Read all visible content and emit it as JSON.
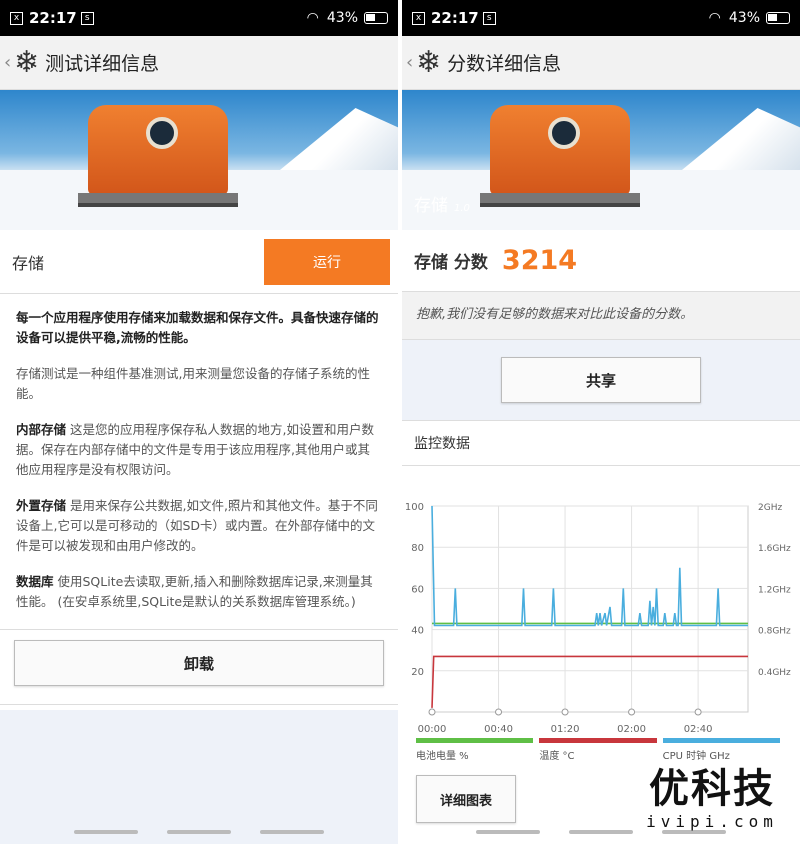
{
  "status_bar": {
    "time": "22:17",
    "battery": "43%"
  },
  "left": {
    "title": "测试详细信息",
    "test_label": "存储",
    "run_label": "运行",
    "intro": "每一个应用程序使用存储来加载数据和保存文件。具备快速存储的设备可以提供平稳,流畅的性能。",
    "para1": "存储测试是一种组件基准测试,用来测量您设备的存储子系统的性能。",
    "internal_term": "内部存储",
    "internal_text": " 这是您的应用程序保存私人数据的地方,如设置和用户数据。保存在内部存储中的文件是专用于该应用程序,其他用户或其他应用程序是没有权限访问。",
    "external_term": "外置存储",
    "external_text": " 是用来保存公共数据,如文件,照片和其他文件。基于不同设备上,它可以是可移动的（如SD卡）或内置。在外部存储中的文件是可以被发现和由用户修改的。",
    "db_term": "数据库",
    "db_text": " 使用SQLite去读取,更新,插入和删除数据库记录,来测量其性能。 (在安卓系统里,SQLite是默认的关系数据库管理系统。)",
    "uninstall_label": "卸载"
  },
  "right": {
    "title": "分数详细信息",
    "hero_label": "存储",
    "hero_version": "1.0",
    "score_label": "存储 分数",
    "score_value": "3214",
    "sorry_text": "抱歉,我们没有足够的数据来对比此设备的分数。",
    "share_label": "共享",
    "monitor_title": "监控数据",
    "detail_label": "详细图表",
    "legend": [
      {
        "label": "电池电量 %",
        "color": "#5fbf46"
      },
      {
        "label": "温度 °C",
        "color": "#c8363c"
      },
      {
        "label": "CPU 时钟 GHz",
        "color": "#4aaede"
      }
    ]
  },
  "watermark": {
    "line1": "优科技",
    "line2": "ivipi.com"
  },
  "chart_data": {
    "type": "line",
    "x_ticks": [
      "00:00",
      "00:40",
      "01:20",
      "02:00",
      "02:40"
    ],
    "x_range_sec": [
      0,
      190
    ],
    "y_left_ticks": [
      20,
      40,
      60,
      80,
      100
    ],
    "y_left_range": [
      0,
      100
    ],
    "y_right_ticks": [
      "0.4GHz",
      "0.8GHz",
      "1.2GHz",
      "1.6GHz",
      "2GHz"
    ],
    "y_right_range_ghz": [
      0,
      2.0
    ],
    "grid": true,
    "series": [
      {
        "name": "电池电量 %",
        "axis": "left",
        "color": "#5fbf46",
        "points": [
          [
            0,
            43
          ],
          [
            1,
            43
          ],
          [
            190,
            43
          ]
        ]
      },
      {
        "name": "温度 °C",
        "axis": "left",
        "color": "#c8363c",
        "points": [
          [
            0,
            2
          ],
          [
            1,
            27
          ],
          [
            190,
            27
          ]
        ]
      },
      {
        "name": "CPU 时钟 GHz",
        "axis": "right",
        "color": "#4aaede",
        "points": [
          [
            0,
            2.0
          ],
          [
            1.5,
            0.84
          ],
          [
            13,
            0.84
          ],
          [
            14,
            1.2
          ],
          [
            15,
            0.84
          ],
          [
            54,
            0.84
          ],
          [
            55,
            1.2
          ],
          [
            56,
            0.84
          ],
          [
            72,
            0.84
          ],
          [
            73,
            1.2
          ],
          [
            74,
            0.84
          ],
          [
            98,
            0.84
          ],
          [
            99,
            0.96
          ],
          [
            100,
            0.84
          ],
          [
            101,
            0.96
          ],
          [
            102,
            0.84
          ],
          [
            104,
            0.96
          ],
          [
            105,
            0.84
          ],
          [
            107,
            1.02
          ],
          [
            108,
            0.84
          ],
          [
            114,
            0.84
          ],
          [
            115,
            1.2
          ],
          [
            116,
            0.84
          ],
          [
            124,
            0.84
          ],
          [
            125,
            0.96
          ],
          [
            126,
            0.84
          ],
          [
            130,
            0.84
          ],
          [
            131,
            1.08
          ],
          [
            132,
            0.84
          ],
          [
            133,
            1.02
          ],
          [
            134,
            0.84
          ],
          [
            135,
            1.2
          ],
          [
            136,
            0.84
          ],
          [
            139,
            0.84
          ],
          [
            140,
            0.96
          ],
          [
            141,
            0.84
          ],
          [
            145,
            0.84
          ],
          [
            146,
            0.96
          ],
          [
            147,
            0.84
          ],
          [
            148,
            0.84
          ],
          [
            149,
            1.4
          ],
          [
            150,
            0.84
          ],
          [
            171,
            0.84
          ],
          [
            172,
            1.2
          ],
          [
            173,
            0.84
          ],
          [
            190,
            0.84
          ]
        ]
      }
    ]
  }
}
